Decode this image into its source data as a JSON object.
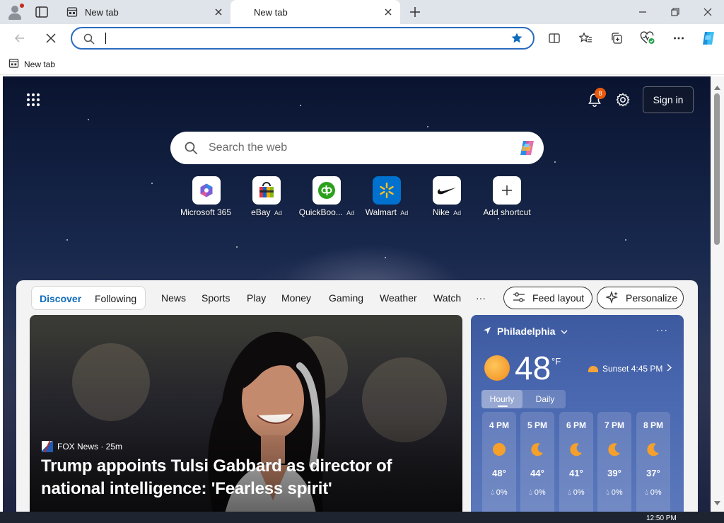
{
  "tabs": [
    {
      "title": "New tab",
      "active": false
    },
    {
      "title": "New tab",
      "active": true
    }
  ],
  "addressbar": {
    "value": "",
    "placeholder": ""
  },
  "favorites": [
    {
      "label": "New tab"
    }
  ],
  "top_right": {
    "notification_count": "8",
    "sign_in_label": "Sign in"
  },
  "search": {
    "placeholder": "Search the web"
  },
  "shortcuts": [
    {
      "name": "Microsoft 365",
      "ad": ""
    },
    {
      "name": "eBay",
      "ad": "Ad"
    },
    {
      "name": "QuickBoo...",
      "ad": "Ad"
    },
    {
      "name": "Walmart",
      "ad": "Ad"
    },
    {
      "name": "Nike",
      "ad": "Ad"
    },
    {
      "name": "Add shortcut",
      "ad": ""
    }
  ],
  "feed": {
    "segments": [
      "Discover",
      "Following"
    ],
    "nav": [
      "News",
      "Sports",
      "Play",
      "Money",
      "Gaming",
      "Weather",
      "Watch",
      "···"
    ],
    "feed_layout_label": "Feed layout",
    "personalize_label": "Personalize"
  },
  "hero": {
    "source": "FOX News · 25m",
    "headline": "Trump appoints Tulsi Gabbard as director of national intelligence: 'Fearless spirit'"
  },
  "weather": {
    "location": "Philadelphia",
    "temperature": "48",
    "unit": "°F",
    "sunset": "Sunset 4:45 PM",
    "toggle": [
      "Hourly",
      "Daily"
    ],
    "hourly": [
      {
        "time": "4 PM",
        "icon": "sun-icon",
        "temp": "48°",
        "precip": "0%"
      },
      {
        "time": "5 PM",
        "icon": "moon-icon",
        "temp": "44°",
        "precip": "0%"
      },
      {
        "time": "6 PM",
        "icon": "moon-icon",
        "temp": "41°",
        "precip": "0%"
      },
      {
        "time": "7 PM",
        "icon": "moon-icon",
        "temp": "39°",
        "precip": "0%"
      },
      {
        "time": "8 PM",
        "icon": "moon-icon",
        "temp": "37°",
        "precip": "0%"
      }
    ]
  },
  "taskbar": {
    "clock": "12:50 PM"
  },
  "colors": {
    "accent": "#0f6cbd",
    "address_border": "#2a6bbf",
    "badge": "#e8590c"
  }
}
